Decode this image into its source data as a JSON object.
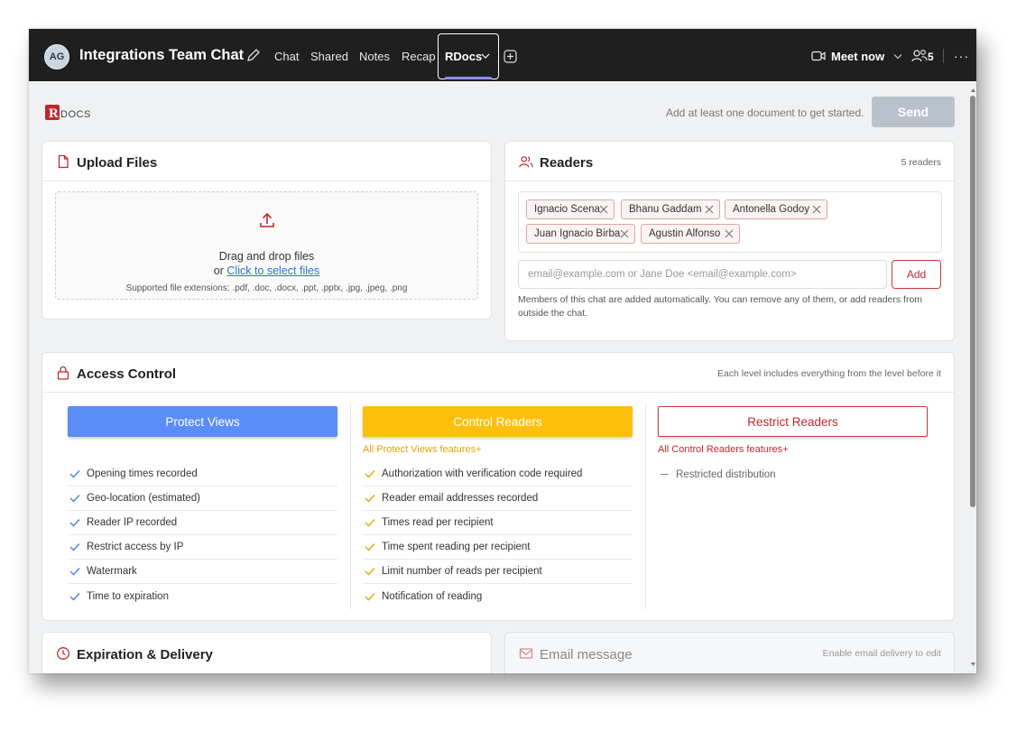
{
  "header": {
    "avatar_initials": "AG",
    "chat_title": "Integrations Team Chat",
    "tabs": [
      "Chat",
      "Shared",
      "Notes",
      "Recap"
    ],
    "active_tab": "RDocs",
    "meet_label": "Meet now",
    "people_count": "5",
    "more": "···"
  },
  "toolbar": {
    "logo_text": "RDOCS",
    "hint": "Add at least one document to get started.",
    "send_label": "Send"
  },
  "upload": {
    "title": "Upload Files",
    "drag_text": "Drag and drop files",
    "or_text": "or",
    "select_link": "Click to select files",
    "supported": "Supported file extensions: .pdf, .doc, .docx, .ppt, .pptx, .jpg, .jpeg, .png"
  },
  "readers": {
    "title": "Readers",
    "count": "5 readers",
    "chips": [
      "Ignacio Scena",
      "Bhanu Gaddam",
      "Antonella Godoy",
      "Juan Ignacio Birba",
      "Agustin Alfonso"
    ],
    "email_placeholder": "email@example.com or Jane Doe <email@example.com>",
    "add_label": "Add",
    "note": "Members of this chat are added automatically. You can remove any of them, or add readers from outside the chat."
  },
  "access": {
    "title": "Access Control",
    "meta": "Each level includes everything from the level before it",
    "protect": {
      "label": "Protect Views",
      "features": [
        "Opening times recorded",
        "Geo-location (estimated)",
        "Reader IP recorded",
        "Restrict access by IP",
        "Watermark",
        "Time to expiration"
      ]
    },
    "control": {
      "label": "Control Readers",
      "sub": "All Protect Views features+",
      "features": [
        "Authorization with verification code required",
        "Reader email addresses recorded",
        "Times read per recipient",
        "Time spent reading per recipient",
        "Limit number of reads per recipient",
        "Notification of reading"
      ]
    },
    "restrict": {
      "label": "Restrict Readers",
      "sub": "All Control Readers features+",
      "features": [
        "Restricted distribution"
      ]
    }
  },
  "expiry": {
    "title": "Expiration & Delivery"
  },
  "email": {
    "title": "Email message",
    "meta": "Enable email delivery to edit"
  },
  "colors": {
    "brand_red": "#c0282f",
    "protect_blue": "#5b8df8",
    "control_yellow": "#fcc00a",
    "send_disabled": "#b9c2cc",
    "topbar": "#1f1f1f",
    "active_tab_underline": "#8b8cf3"
  },
  "icons": [
    "edit-icon",
    "chevron-down-icon",
    "add-tab-icon",
    "video-icon",
    "people-icon",
    "more-icon",
    "file-icon",
    "upload-icon",
    "readers-icon",
    "close-icon",
    "lock-icon",
    "check-icon",
    "clock-icon",
    "mail-icon"
  ]
}
